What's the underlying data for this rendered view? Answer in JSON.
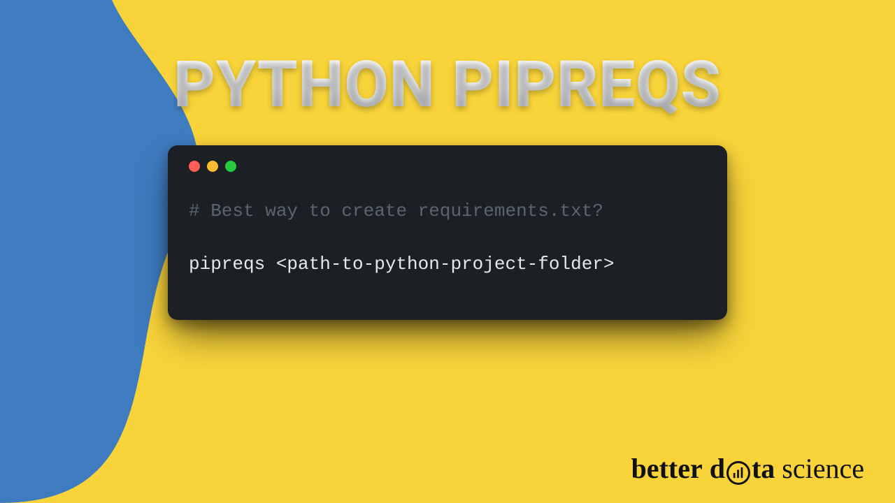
{
  "title": "PYTHON PIPREQS",
  "terminal": {
    "comment": "# Best way to create requirements.txt?",
    "command": "pipreqs <path-to-python-project-folder>"
  },
  "brand": {
    "word1": "better",
    "word2_pre": "d",
    "word2_post": "ta",
    "word3": "science"
  },
  "colors": {
    "blue": "#3f7bbf",
    "yellow": "#f8d33a",
    "terminal_bg": "#1c1f23"
  }
}
